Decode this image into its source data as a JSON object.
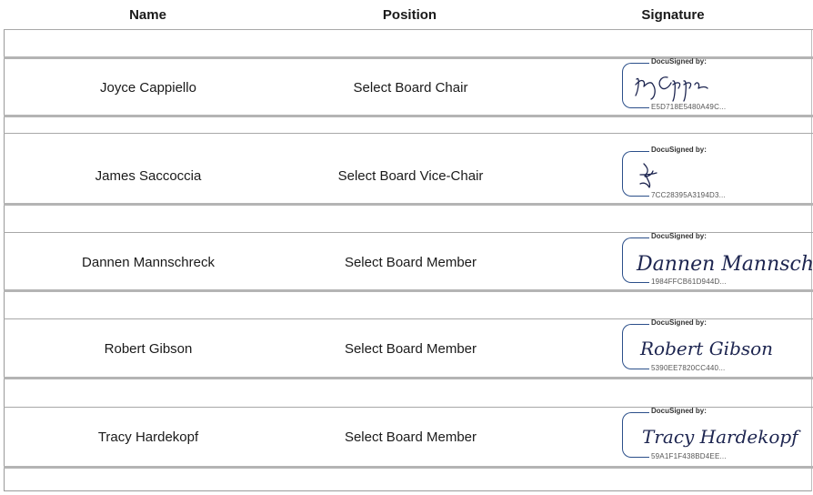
{
  "table": {
    "columns": [
      "Name",
      "Position",
      "Signature"
    ],
    "rows": [
      {
        "name": "Joyce Cappiello",
        "position": "Select Board Chair",
        "docusigned_label": "DocuSigned by:",
        "signature_text": "Joyce Cappiello",
        "envelope_id": "E5D718E5480A49C..."
      },
      {
        "name": "James Saccoccia",
        "position": "Select Board Vice-Chair",
        "docusigned_label": "DocuSigned by:",
        "signature_text": "James Saccoccia",
        "envelope_id": "7CC28395A3194D3..."
      },
      {
        "name": "Dannen Mannschreck",
        "position": "Select Board Member",
        "docusigned_label": "DocuSigned by:",
        "signature_text": "Dannen Mannschreck",
        "envelope_id": "1984FFCB61D944D..."
      },
      {
        "name": "Robert Gibson",
        "position": "Select Board Member",
        "docusigned_label": "DocuSigned by:",
        "signature_text": "Robert Gibson",
        "envelope_id": "5390EE7820CC440..."
      },
      {
        "name": "Tracy Hardekopf",
        "position": "Select Board Member",
        "docusigned_label": "DocuSigned by:",
        "signature_text": "Tracy Hardekopf",
        "envelope_id": "59A1F1F438BD4EE..."
      }
    ]
  },
  "colors": {
    "bracket": "#2b4f8a",
    "ink": "#1d2550",
    "rule": "#a8a8a8"
  }
}
